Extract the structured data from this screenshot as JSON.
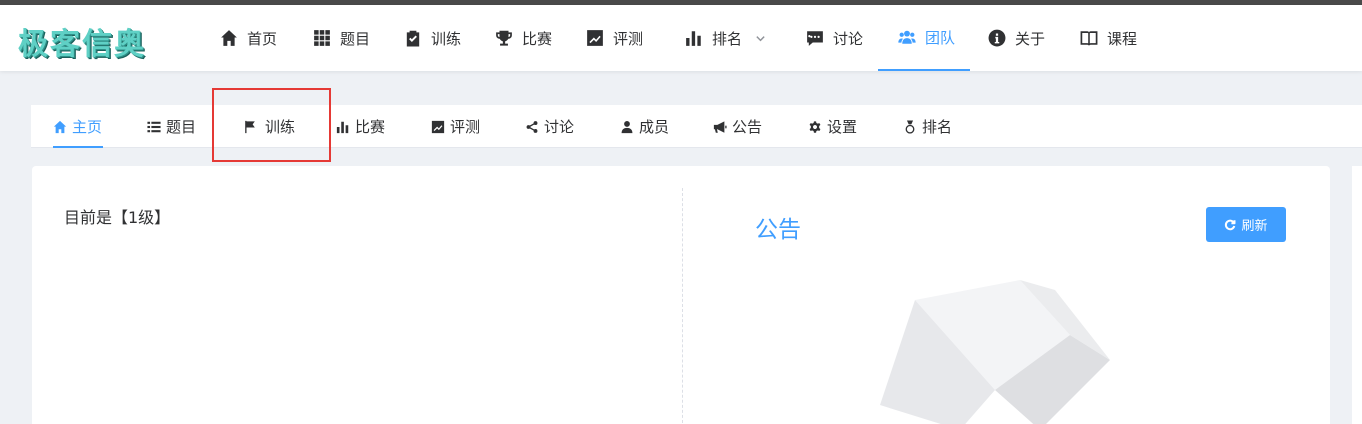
{
  "app": {
    "logo_text": "极客信奥"
  },
  "navbar": {
    "items": [
      {
        "label": "首页",
        "icon": "home-icon"
      },
      {
        "label": "题目",
        "icon": "grid-icon"
      },
      {
        "label": "训练",
        "icon": "clipboard-check-icon"
      },
      {
        "label": "比赛",
        "icon": "trophy-icon"
      },
      {
        "label": "评测",
        "icon": "chart-line-icon"
      },
      {
        "label": "排名",
        "icon": "bar-chart-icon",
        "has_dropdown": true
      },
      {
        "label": "讨论",
        "icon": "comment-icon"
      },
      {
        "label": "团队",
        "icon": "users-icon",
        "active": true
      },
      {
        "label": "关于",
        "icon": "info-circle-icon"
      },
      {
        "label": "课程",
        "icon": "book-icon"
      }
    ]
  },
  "subnav": {
    "items": [
      {
        "label": "主页",
        "icon": "home-icon",
        "active": true
      },
      {
        "label": "题目",
        "icon": "list-icon"
      },
      {
        "label": "训练",
        "icon": "flag-icon",
        "highlighted": true
      },
      {
        "label": "比赛",
        "icon": "bar-chart-icon"
      },
      {
        "label": "评测",
        "icon": "chart-line-icon"
      },
      {
        "label": "讨论",
        "icon": "share-icon"
      },
      {
        "label": "成员",
        "icon": "user-icon"
      },
      {
        "label": "公告",
        "icon": "bullhorn-icon"
      },
      {
        "label": "设置",
        "icon": "gear-icon"
      },
      {
        "label": "排名",
        "icon": "medal-icon"
      }
    ]
  },
  "main": {
    "level_text": "目前是【1级】",
    "notice": {
      "title": "公告",
      "refresh_label": "刷新",
      "refresh_icon": "refresh-icon"
    }
  },
  "colors": {
    "accent": "#409eff",
    "highlight_border": "#e53935",
    "logo": "#5fd0c5"
  }
}
